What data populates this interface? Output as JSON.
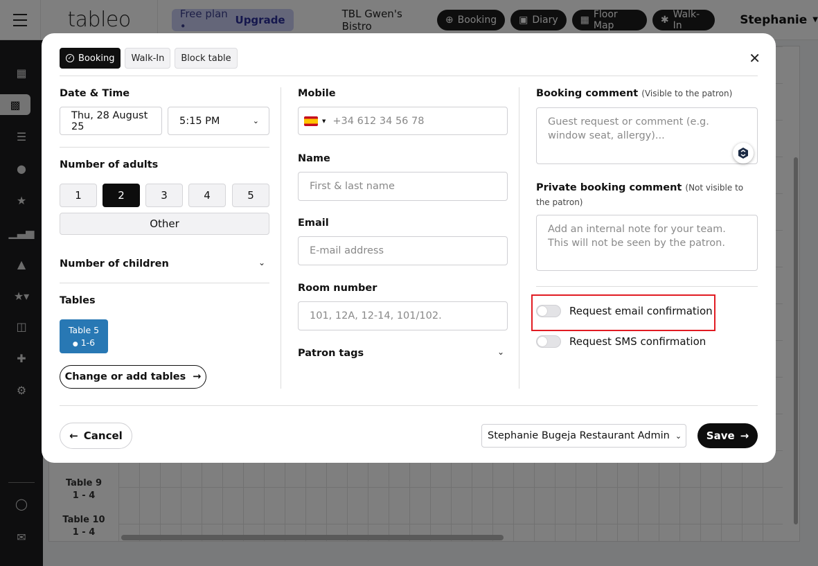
{
  "topbar": {
    "logo": "tableo",
    "plan_text": "Free plan •",
    "upgrade": "Upgrade",
    "venue": "TBL Gwen's Bistro",
    "nav": [
      "Booking",
      "Diary",
      "Floor Map",
      "Walk-In"
    ],
    "user": "Stephanie"
  },
  "background": {
    "rows": [
      {
        "name": "Table 9",
        "capacity": "1 - 4"
      },
      {
        "name": "Table 10",
        "capacity": "1 - 4"
      }
    ]
  },
  "modal": {
    "tabs": [
      "Booking",
      "Walk-In",
      "Block table"
    ],
    "date_time": {
      "label": "Date & Time",
      "date": "Thu, 28 August 25",
      "time": "5:15 PM"
    },
    "adults": {
      "label": "Number of adults",
      "options": [
        "1",
        "2",
        "3",
        "4",
        "5"
      ],
      "selected": "2",
      "other": "Other"
    },
    "children": {
      "label": "Number of children"
    },
    "tables": {
      "label": "Tables",
      "selected_table": "Table 5",
      "selected_capacity": "1-6",
      "change_button": "Change or add tables"
    },
    "mobile": {
      "label": "Mobile",
      "placeholder": "+34 612 34 56 78"
    },
    "name": {
      "label": "Name",
      "placeholder": "First & last name"
    },
    "email": {
      "label": "Email",
      "placeholder": "E-mail address"
    },
    "room": {
      "label": "Room number",
      "placeholder": "101, 12A, 12-14, 101/102."
    },
    "patron_tags": {
      "label": "Patron tags"
    },
    "booking_comment": {
      "label": "Booking comment",
      "sub": "(Visible to the patron)",
      "placeholder": "Guest request or comment (e.g. window seat, allergy)..."
    },
    "private_comment": {
      "label": "Private booking comment",
      "sub": "(Not visible to the patron)",
      "placeholder": "Add an internal note for your team. This will not be seen by the patron."
    },
    "toggles": {
      "email_confirmation": {
        "label": "Request email confirmation",
        "on": false
      },
      "sms_confirmation": {
        "label": "Request SMS confirmation",
        "on": false
      }
    },
    "footer": {
      "cancel": "Cancel",
      "staff": "Stephanie Bugeja Restaurant Admin",
      "save": "Save"
    }
  },
  "colors": {
    "accent_dark": "#0d0d0d",
    "table_chip": "#2878b4",
    "highlight": "#e11b22",
    "plan_pill": "#c9cdf2"
  }
}
